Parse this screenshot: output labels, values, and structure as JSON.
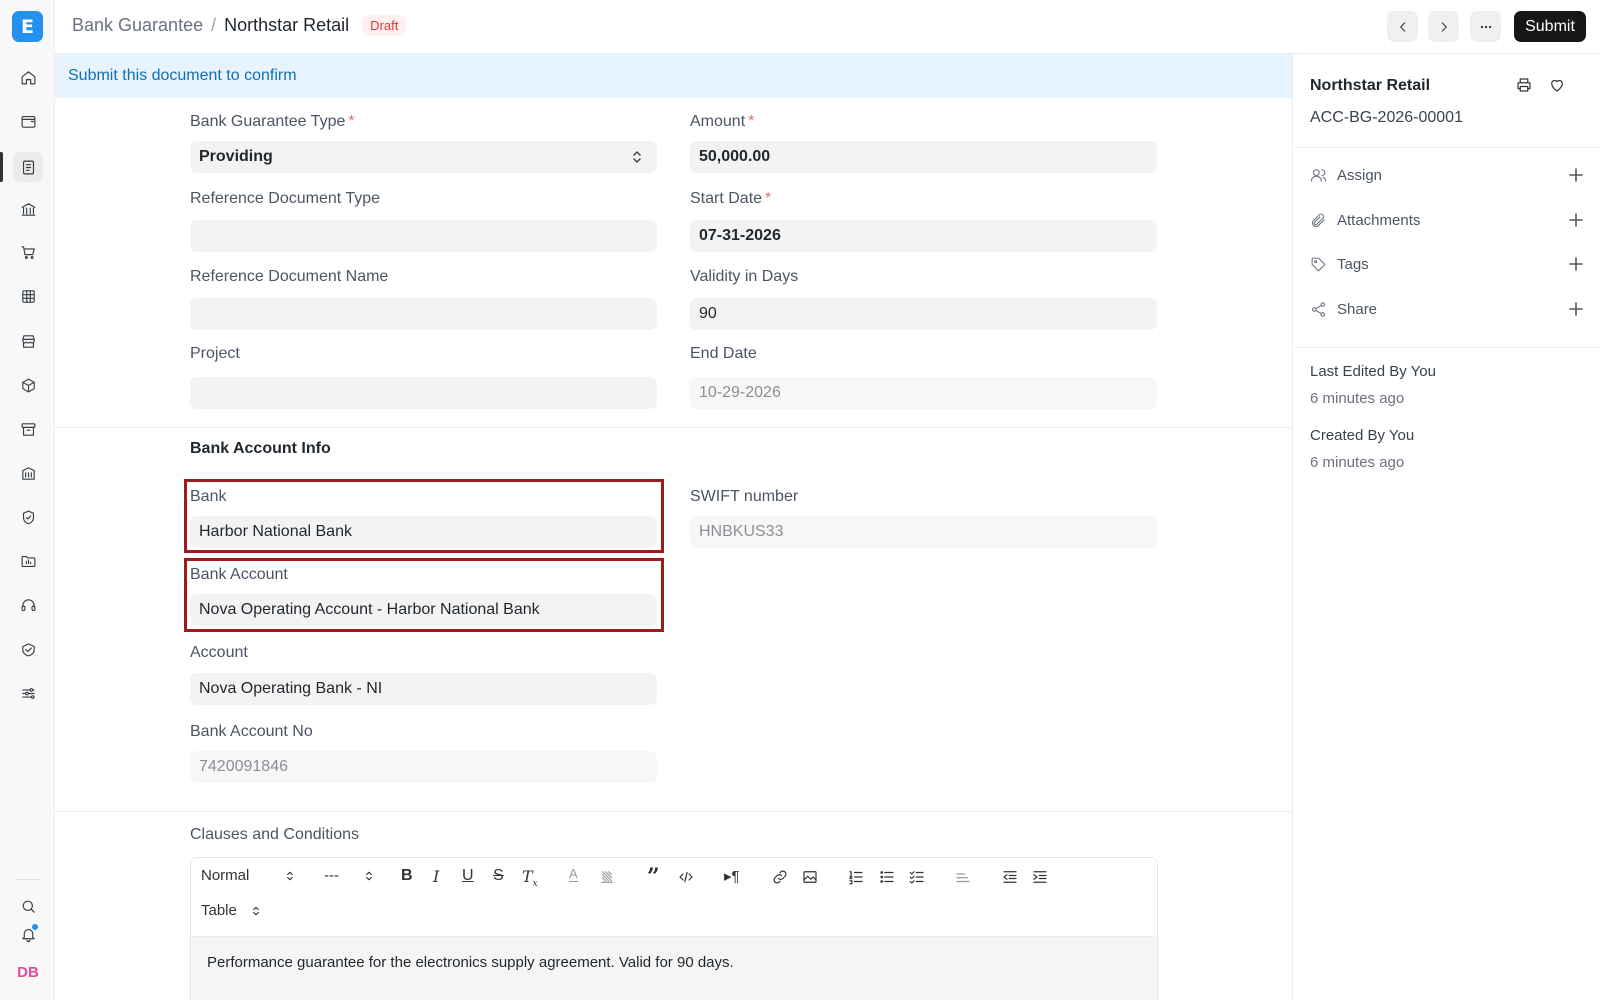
{
  "app": {
    "logo_letter": "E",
    "avatar_initials": "DB"
  },
  "breadcrumb": {
    "parent": "Bank Guarantee",
    "separator": "/",
    "current": "Northstar Retail",
    "status": "Draft"
  },
  "toolbar": {
    "submit_label": "Submit"
  },
  "banner": {
    "text": "Submit this document to confirm"
  },
  "form": {
    "bank_guarantee_type": {
      "label": "Bank Guarantee Type",
      "value": "Providing",
      "required": "*"
    },
    "reference_document_type": {
      "label": "Reference Document Type",
      "value": ""
    },
    "reference_document_name": {
      "label": "Reference Document Name",
      "value": ""
    },
    "project": {
      "label": "Project",
      "value": ""
    },
    "amount": {
      "label": "Amount",
      "value": "50,000.00",
      "required": "*"
    },
    "start_date": {
      "label": "Start Date",
      "value": "07-31-2026",
      "required": "*"
    },
    "validity_in_days": {
      "label": "Validity in Days",
      "value": "90"
    },
    "end_date": {
      "label": "End Date",
      "value": "10-29-2026"
    }
  },
  "bank_section": {
    "title": "Bank Account Info",
    "bank": {
      "label": "Bank",
      "value": "Harbor National Bank"
    },
    "bank_account": {
      "label": "Bank Account",
      "value": "Nova Operating Account - Harbor National Bank"
    },
    "account": {
      "label": "Account",
      "value": "Nova Operating Bank - NI"
    },
    "bank_account_no": {
      "label": "Bank Account No",
      "value": "7420091846"
    },
    "swift_number": {
      "label": "SWIFT number",
      "value": "HNBKUS33"
    }
  },
  "clauses": {
    "label": "Clauses and Conditions",
    "toolbar": {
      "style_select": "Normal",
      "size_select": "---",
      "table_select": "Table"
    },
    "content": "Performance guarantee for the electronics supply agreement. Valid for 90 days."
  },
  "sidebar_panel": {
    "title": "Northstar Retail",
    "doc_id": "ACC-BG-2026-00001",
    "actions": [
      {
        "label": "Assign"
      },
      {
        "label": "Attachments"
      },
      {
        "label": "Tags"
      },
      {
        "label": "Share"
      }
    ],
    "last_edited": "Last Edited By You",
    "last_edited_time": "6 minutes ago",
    "created": "Created By You",
    "created_time": "6 minutes ago"
  },
  "colors": {
    "accent": "#2490ef",
    "highlight_box": "#9a1c1c",
    "banner_bg": "#e8f4fd",
    "draft_badge": "#e03636"
  },
  "icons": {
    "sidebar": [
      "home-icon",
      "wallet-icon",
      "invoice-icon",
      "bank-icon",
      "cart-icon",
      "table-icon",
      "store-icon",
      "box-icon",
      "archive-icon",
      "building-icon",
      "shield-icon",
      "folder-icon",
      "headset-icon",
      "handshake-icon",
      "sliders-icon",
      "search-icon",
      "bell-icon"
    ]
  }
}
